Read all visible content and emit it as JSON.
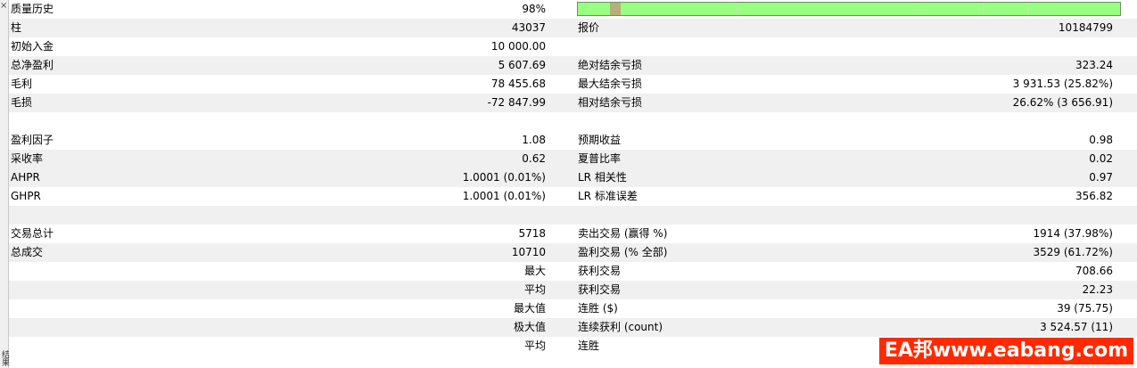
{
  "side": {
    "close": "×",
    "tab": "结果"
  },
  "rows": [
    {
      "l1": "质量历史",
      "v1": "98%",
      "l2": "",
      "v2": ""
    },
    {
      "l1": "柱",
      "v1": "43037",
      "l2": "报价",
      "v2": "10184799"
    },
    {
      "l1": "初始入金",
      "v1": "10 000.00",
      "l2": "",
      "v2": ""
    },
    {
      "l1": "总净盈利",
      "v1": "5 607.69",
      "l2": "绝对结余亏损",
      "v2": "323.24"
    },
    {
      "l1": "毛利",
      "v1": "78 455.68",
      "l2": "最大结余亏损",
      "v2": "3 931.53 (25.82%)"
    },
    {
      "l1": "毛损",
      "v1": "-72 847.99",
      "l2": "相对结余亏损",
      "v2": "26.62% (3 656.91)"
    },
    {
      "l1": "",
      "v1": "",
      "l2": "",
      "v2": ""
    },
    {
      "l1": "盈利因子",
      "v1": "1.08",
      "l2": "预期收益",
      "v2": "0.98"
    },
    {
      "l1": "采收率",
      "v1": "0.62",
      "l2": "夏普比率",
      "v2": "0.02"
    },
    {
      "l1": "AHPR",
      "v1": "1.0001 (0.01%)",
      "l2": "LR 相关性",
      "v2": "0.97"
    },
    {
      "l1": "GHPR",
      "v1": "1.0001 (0.01%)",
      "l2": "LR 标准误差",
      "v2": "356.82"
    },
    {
      "l1": "",
      "v1": "",
      "l2": "",
      "v2": ""
    },
    {
      "l1": "交易总计",
      "v1": "5718",
      "l2": "卖出交易 (赢得 %)",
      "v2": "1914 (37.98%)"
    },
    {
      "l1": "总成交",
      "v1": "10710",
      "l2": "盈利交易 (% 全部)",
      "v2": "3529 (61.72%)"
    },
    {
      "l1": "",
      "v1": "最大",
      "l2": "获利交易",
      "v2": "708.66"
    },
    {
      "l1": "",
      "v1": "平均",
      "l2": "获利交易",
      "v2": "22.23"
    },
    {
      "l1": "",
      "v1": "最大值",
      "l2": "连胜 ($)",
      "v2": "39 (75.75)"
    },
    {
      "l1": "",
      "v1": "极大值",
      "l2": "连续获利 (count)",
      "v2": "3 524.57 (11)"
    },
    {
      "l1": "",
      "v1": "平均",
      "l2": "连胜",
      "v2": ""
    }
  ],
  "quality_bar": {
    "fill_percent": 98,
    "color": "#99ff80",
    "marker_color": "#b5b075"
  },
  "watermark": {
    "text": "EA邦www.eabang.com",
    "color": "#ff2a00"
  }
}
